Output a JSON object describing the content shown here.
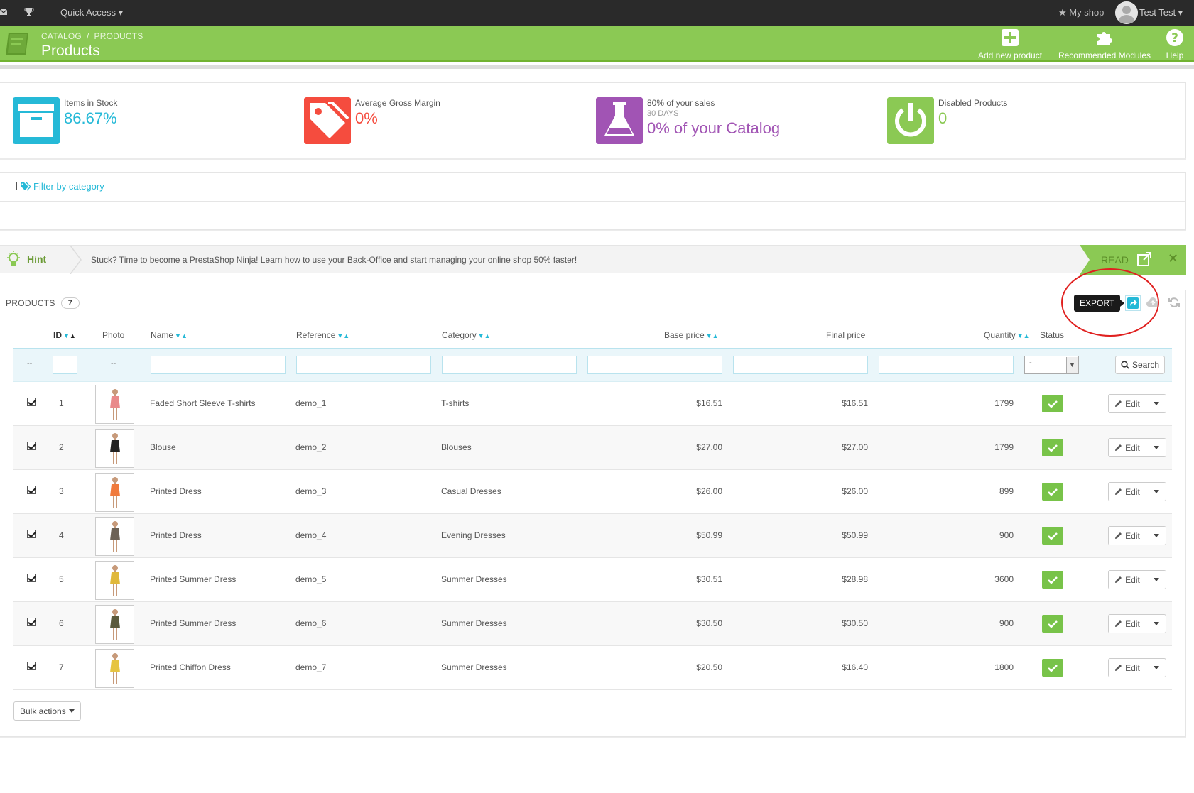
{
  "topbar": {
    "quick_access": "Quick Access",
    "my_shop": "My shop",
    "user": "Test Test"
  },
  "header": {
    "breadcrumb": [
      "CATALOG",
      "PRODUCTS"
    ],
    "title": "Products",
    "buttons": {
      "add": "Add new product",
      "modules": "Recommended Modules",
      "help": "Help"
    }
  },
  "kpis": [
    {
      "label": "Items in Stock",
      "sub": "",
      "value": "86.67%",
      "color": "#25b9d7"
    },
    {
      "label": "Average Gross Margin",
      "sub": "",
      "value": "0%",
      "color": "#f54c3e"
    },
    {
      "label": "80% of your sales",
      "sub": "30 DAYS",
      "value": "0% of your Catalog",
      "color": "#a154b4"
    },
    {
      "label": "Disabled Products",
      "sub": "",
      "value": "0",
      "color": "#8bc954"
    }
  ],
  "filter": {
    "link": "Filter by category"
  },
  "hint": {
    "title": "Hint",
    "text": "Stuck? Time to become a PrestaShop Ninja! Learn how to use your Back-Office and start managing your online shop 50% faster!",
    "read": "READ"
  },
  "panel": {
    "title": "PRODUCTS",
    "count": "7",
    "tooltip": "EXPORT"
  },
  "table": {
    "headers": {
      "id": "ID",
      "photo": "Photo",
      "name": "Name",
      "reference": "Reference",
      "category": "Category",
      "base_price": "Base price",
      "final_price": "Final price",
      "quantity": "Quantity",
      "status": "Status"
    },
    "filter_dash": "--",
    "select_value": "-",
    "search_label": "Search",
    "edit_label": "Edit",
    "rows": [
      {
        "id": "1",
        "name": "Faded Short Sleeve T-shirts",
        "reference": "demo_1",
        "category": "T-shirts",
        "base_price": "$16.51",
        "final_price": "$16.51",
        "quantity": "1799",
        "dress": "#e98a8a"
      },
      {
        "id": "2",
        "name": "Blouse",
        "reference": "demo_2",
        "category": "Blouses",
        "base_price": "$27.00",
        "final_price": "$27.00",
        "quantity": "1799",
        "dress": "#222222"
      },
      {
        "id": "3",
        "name": "Printed Dress",
        "reference": "demo_3",
        "category": "Casual Dresses",
        "base_price": "$26.00",
        "final_price": "$26.00",
        "quantity": "899",
        "dress": "#f07a3c"
      },
      {
        "id": "4",
        "name": "Printed Dress",
        "reference": "demo_4",
        "category": "Evening Dresses",
        "base_price": "$50.99",
        "final_price": "$50.99",
        "quantity": "900",
        "dress": "#6d6256"
      },
      {
        "id": "5",
        "name": "Printed Summer Dress",
        "reference": "demo_5",
        "category": "Summer Dresses",
        "base_price": "$30.51",
        "final_price": "$28.98",
        "quantity": "3600",
        "dress": "#e0b83a"
      },
      {
        "id": "6",
        "name": "Printed Summer Dress",
        "reference": "demo_6",
        "category": "Summer Dresses",
        "base_price": "$30.50",
        "final_price": "$30.50",
        "quantity": "900",
        "dress": "#5c5a3c"
      },
      {
        "id": "7",
        "name": "Printed Chiffon Dress",
        "reference": "demo_7",
        "category": "Summer Dresses",
        "base_price": "$20.50",
        "final_price": "$16.40",
        "quantity": "1800",
        "dress": "#e6c441"
      }
    ]
  },
  "bulk_actions": "Bulk actions"
}
